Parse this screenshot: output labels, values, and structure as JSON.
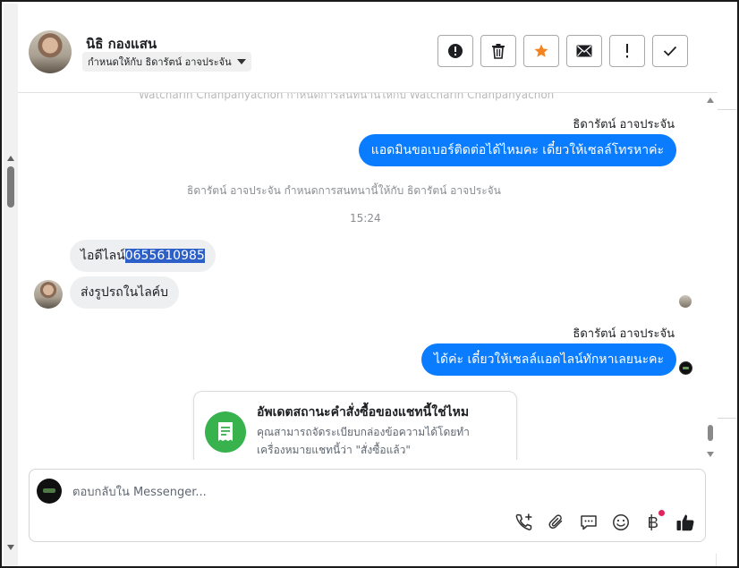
{
  "header": {
    "contact_name": "นิธิ กองแสน",
    "assigned_to": "กำหนดให้กับ ธิดารัตน์ อาจประจัน"
  },
  "conversation": {
    "top_system_text": "Watcharin Chanpanyachon กำหนดการสนทนานี้ให้กับ Watcharin Chanpanyachon",
    "messages": [
      {
        "sender": "ธิดารัตน์ อาจประจัน",
        "text": "แอดมินขอเบอร์ติดต่อได้ไหมคะ เดี๋ยวให้เซลล์โทรหาค่ะ"
      },
      {
        "system": "ธิดารัตน์ อาจประจัน กำหนดการสนทนานี้ให้กับ ธิดารัตน์ อาจประจัน"
      },
      {
        "time": "15:24"
      },
      {
        "in_prefix": "ไอดีไลน์",
        "in_highlight": "0655610985"
      },
      {
        "in_text": "ส่งรูปรถในไลค์บ"
      },
      {
        "sender": "ธิดารัตน์ อาจประจัน",
        "text": "ได้ค่ะ เดี๋ยวให้เซลล์แอดไลน์ทักหาเลยนะคะ"
      }
    ],
    "card": {
      "title": "อัพเดตสถานะคำสั่งซื้อของแชทนี้ใช่ไหม",
      "body": "คุณสามารถจัดระเบียบกล่องข้อความได้โดยทำเครื่องหมายแชทนี้ว่า \"สั่งซื้อแล้ว\""
    }
  },
  "composer": {
    "placeholder": "ตอบกลับใน Messenger..."
  },
  "colors": {
    "outgoing_bubble": "#0a7cff",
    "incoming_bubble": "#eeeff1",
    "star": "#f5831f",
    "card_icon": "#37b24d",
    "notification_dot": "#e0245e"
  },
  "icons": {
    "header_actions": [
      "alert-circle-icon",
      "trash-icon",
      "star-icon",
      "envelope-icon",
      "exclamation-icon",
      "check-icon"
    ],
    "composer_tools": [
      "phone-add-icon",
      "paperclip-icon",
      "chat-bubble-icon",
      "smiley-icon",
      "baht-icon",
      "thumbs-up-icon"
    ]
  }
}
